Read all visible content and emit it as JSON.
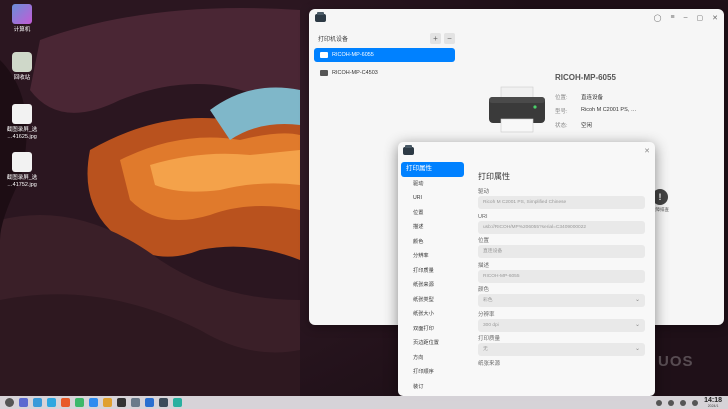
{
  "desktop": {
    "icons": [
      {
        "label": "计算机",
        "icon": "computer-icon"
      },
      {
        "label": "回收站",
        "icon": "trash-icon"
      },
      {
        "label": "截图录屏_选\n…41625.jpg",
        "icon": "image-file-icon"
      },
      {
        "label": "截图录屏_选\n…41752.jpg",
        "icon": "image-file-icon"
      }
    ],
    "watermark": "UOS"
  },
  "printer_manager": {
    "sidebar_title": "打印机设备",
    "add_label": "+",
    "remove_label": "−",
    "printers": [
      {
        "name": "RICOH-MP-6055",
        "selected": true
      },
      {
        "name": "RICOH-MP-C4503",
        "selected": false
      }
    ],
    "selected_printer": {
      "name": "RICOH-MP-6055",
      "details": [
        {
          "key": "位置:",
          "value": "直连设备"
        },
        {
          "key": "型号:",
          "value": "Ricoh M C2001 PS, …"
        },
        {
          "key": "状态:",
          "value": "空闲"
        }
      ]
    },
    "trouble_tool_label": "故障排查",
    "accent": "#0081ff"
  },
  "properties_dialog": {
    "nav_items": [
      "打印属性",
      "驱动",
      "URI",
      "位置",
      "描述",
      "颜色",
      "分辨率",
      "打印质量",
      "纸张来源",
      "纸张类型",
      "纸张大小",
      "双面打印",
      "页边距位置",
      "方向",
      "打印顺序",
      "装订"
    ],
    "section_title": "打印属性",
    "fields": [
      {
        "label": "驱动",
        "value": "Ricoh M C2001 PS, Simplified Chinese",
        "dropdown": false
      },
      {
        "label": "URI",
        "value": "usb://RICOH/MP%206055?serial=C3409000022",
        "dropdown": false
      },
      {
        "label": "位置",
        "value": "直连设备",
        "dropdown": false
      },
      {
        "label": "描述",
        "value": "RICOH-MP-6055",
        "dropdown": false
      },
      {
        "label": "颜色",
        "value": "彩色",
        "dropdown": true
      },
      {
        "label": "分辨率",
        "value": "300 dpi",
        "dropdown": true
      },
      {
        "label": "打印质量",
        "value": "无",
        "dropdown": true
      },
      {
        "label": "纸张来源",
        "value": "",
        "dropdown": true
      }
    ]
  },
  "taskbar": {
    "time": "14:18",
    "date": "2024/1"
  }
}
